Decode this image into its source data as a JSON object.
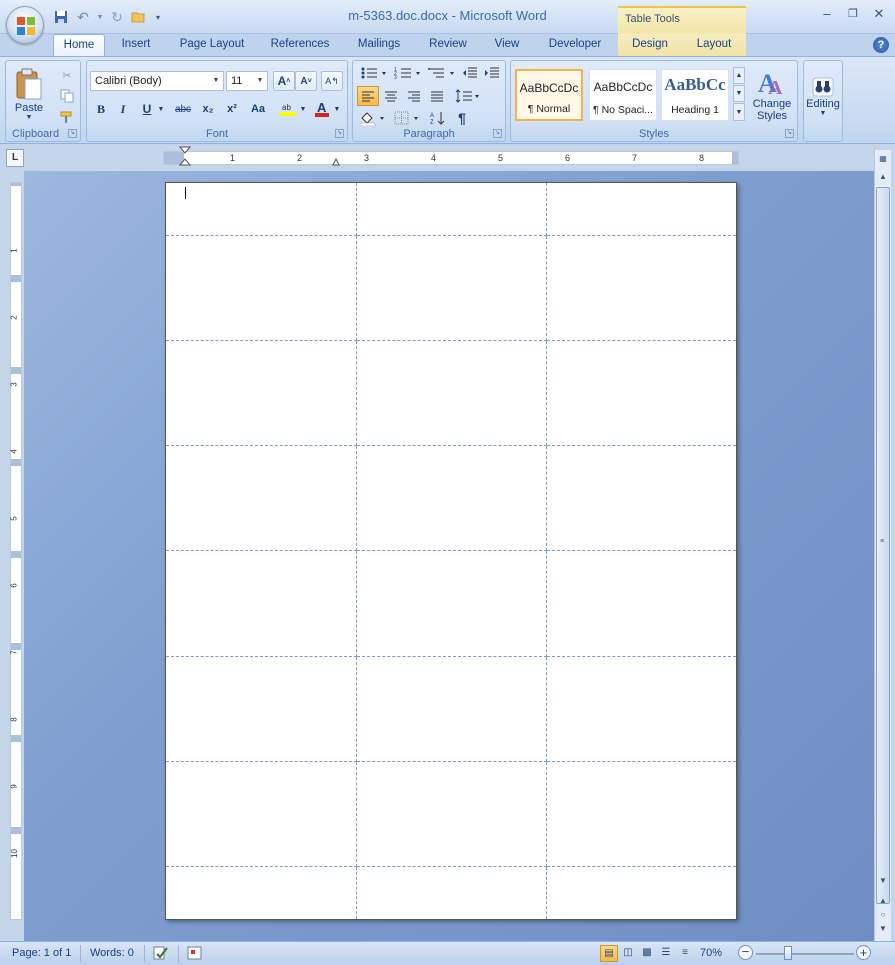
{
  "window": {
    "title": "m-5363.doc.docx - Microsoft Word",
    "context_tab_group": "Table Tools"
  },
  "tabs": [
    "Home",
    "Insert",
    "Page Layout",
    "References",
    "Mailings",
    "Review",
    "View",
    "Developer",
    "Design",
    "Layout"
  ],
  "active_tab": "Home",
  "ribbon": {
    "clipboard": {
      "label": "Clipboard",
      "paste": "Paste"
    },
    "font": {
      "label": "Font",
      "font_name": "Calibri (Body)",
      "font_size": "11",
      "bold": "B",
      "italic": "I",
      "underline": "U",
      "strike": "abc",
      "subscript": "x₂",
      "superscript": "x²",
      "change_case": "Aa"
    },
    "paragraph": {
      "label": "Paragraph",
      "show_marks": "¶"
    },
    "styles": {
      "label": "Styles",
      "gallery": [
        {
          "preview": "AaBbCcDc",
          "name": "¶ Normal"
        },
        {
          "preview": "AaBbCcDc",
          "name": "¶ No Spaci..."
        },
        {
          "preview": "AaBbCc",
          "name": "Heading 1"
        }
      ],
      "change_styles": "Change Styles"
    },
    "editing": {
      "label": "Editing"
    }
  },
  "ruler": {
    "h_numbers": [
      "1",
      "2",
      "3",
      "4",
      "5",
      "6",
      "7",
      "8"
    ],
    "v_numbers": [
      "1",
      "2",
      "3",
      "4",
      "5",
      "6",
      "7",
      "8",
      "9",
      "10"
    ]
  },
  "document": {
    "table_rows": 8,
    "table_cols": 3
  },
  "status": {
    "page": "Page: 1 of 1",
    "words": "Words: 0",
    "zoom": "70%"
  },
  "colors": {
    "accent": "#15428b",
    "ribbon_bg": "#c9dcf2",
    "pressed": "#f8b948",
    "doc_bg": "#7f9fd0"
  }
}
